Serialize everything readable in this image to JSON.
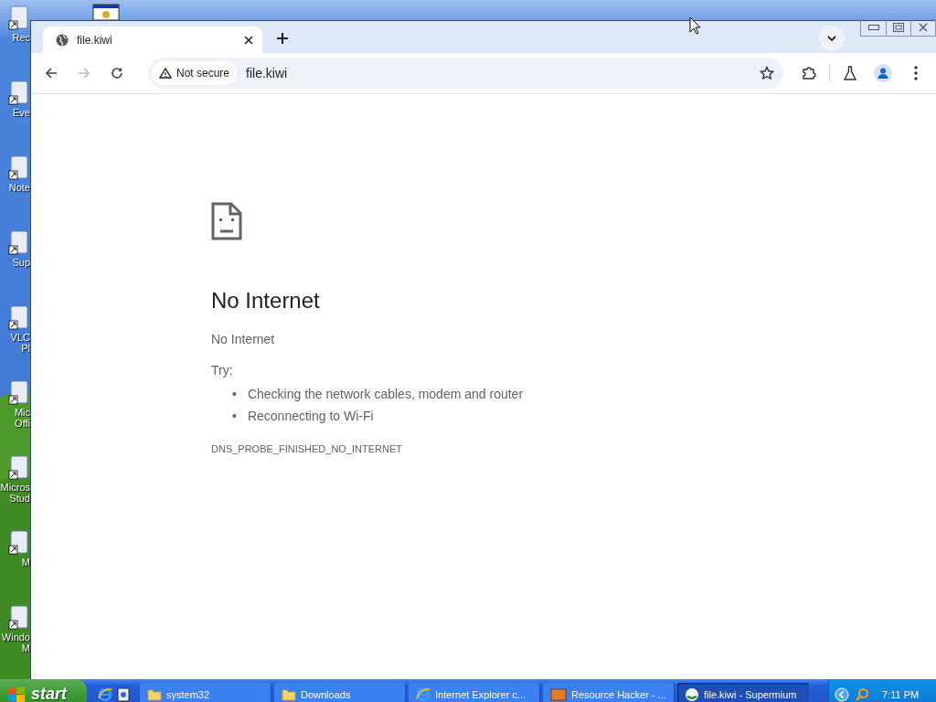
{
  "desktop_icons": [
    {
      "lines": [
        "Rec"
      ]
    },
    {
      "lines": [
        "Eve"
      ]
    },
    {
      "lines": [
        "Note"
      ]
    },
    {
      "lines": [
        "Sup"
      ]
    },
    {
      "lines": [
        "VLC",
        "Pl"
      ]
    },
    {
      "lines": [
        "Mic",
        "Offi"
      ]
    },
    {
      "lines": [
        "Micros",
        "Stud"
      ]
    },
    {
      "lines": [
        "M"
      ]
    },
    {
      "lines": [
        "Windo",
        "M"
      ]
    }
  ],
  "browser": {
    "tabs": [
      {
        "title": "file.kiwi",
        "selected": true
      }
    ],
    "address": {
      "security": "Not secure",
      "url": "file.kiwi"
    },
    "error": {
      "title": "No Internet",
      "message": "No Internet",
      "try_label": "Try:",
      "suggestions": [
        {
          "marker": "•",
          "text": "Checking the network cables, modem and router"
        },
        {
          "marker": "•",
          "text": "Reconnecting to Wi-Fi"
        }
      ],
      "code": "DNS_PROBE_FINISHED_NO_INTERNET"
    }
  },
  "taskbar": {
    "start": "start",
    "windows": [
      {
        "label": "system32",
        "kind": "folder",
        "selected": false
      },
      {
        "label": "Downloads",
        "kind": "folder",
        "selected": false
      },
      {
        "label": "Internet Explorer c...",
        "kind": "ie",
        "selected": false
      },
      {
        "label": "Resource Hacker - ...",
        "kind": "rh",
        "selected": false
      },
      {
        "label": "file.kiwi - Supermium",
        "kind": "browser",
        "selected": true
      }
    ],
    "clock": "7:11 PM"
  }
}
